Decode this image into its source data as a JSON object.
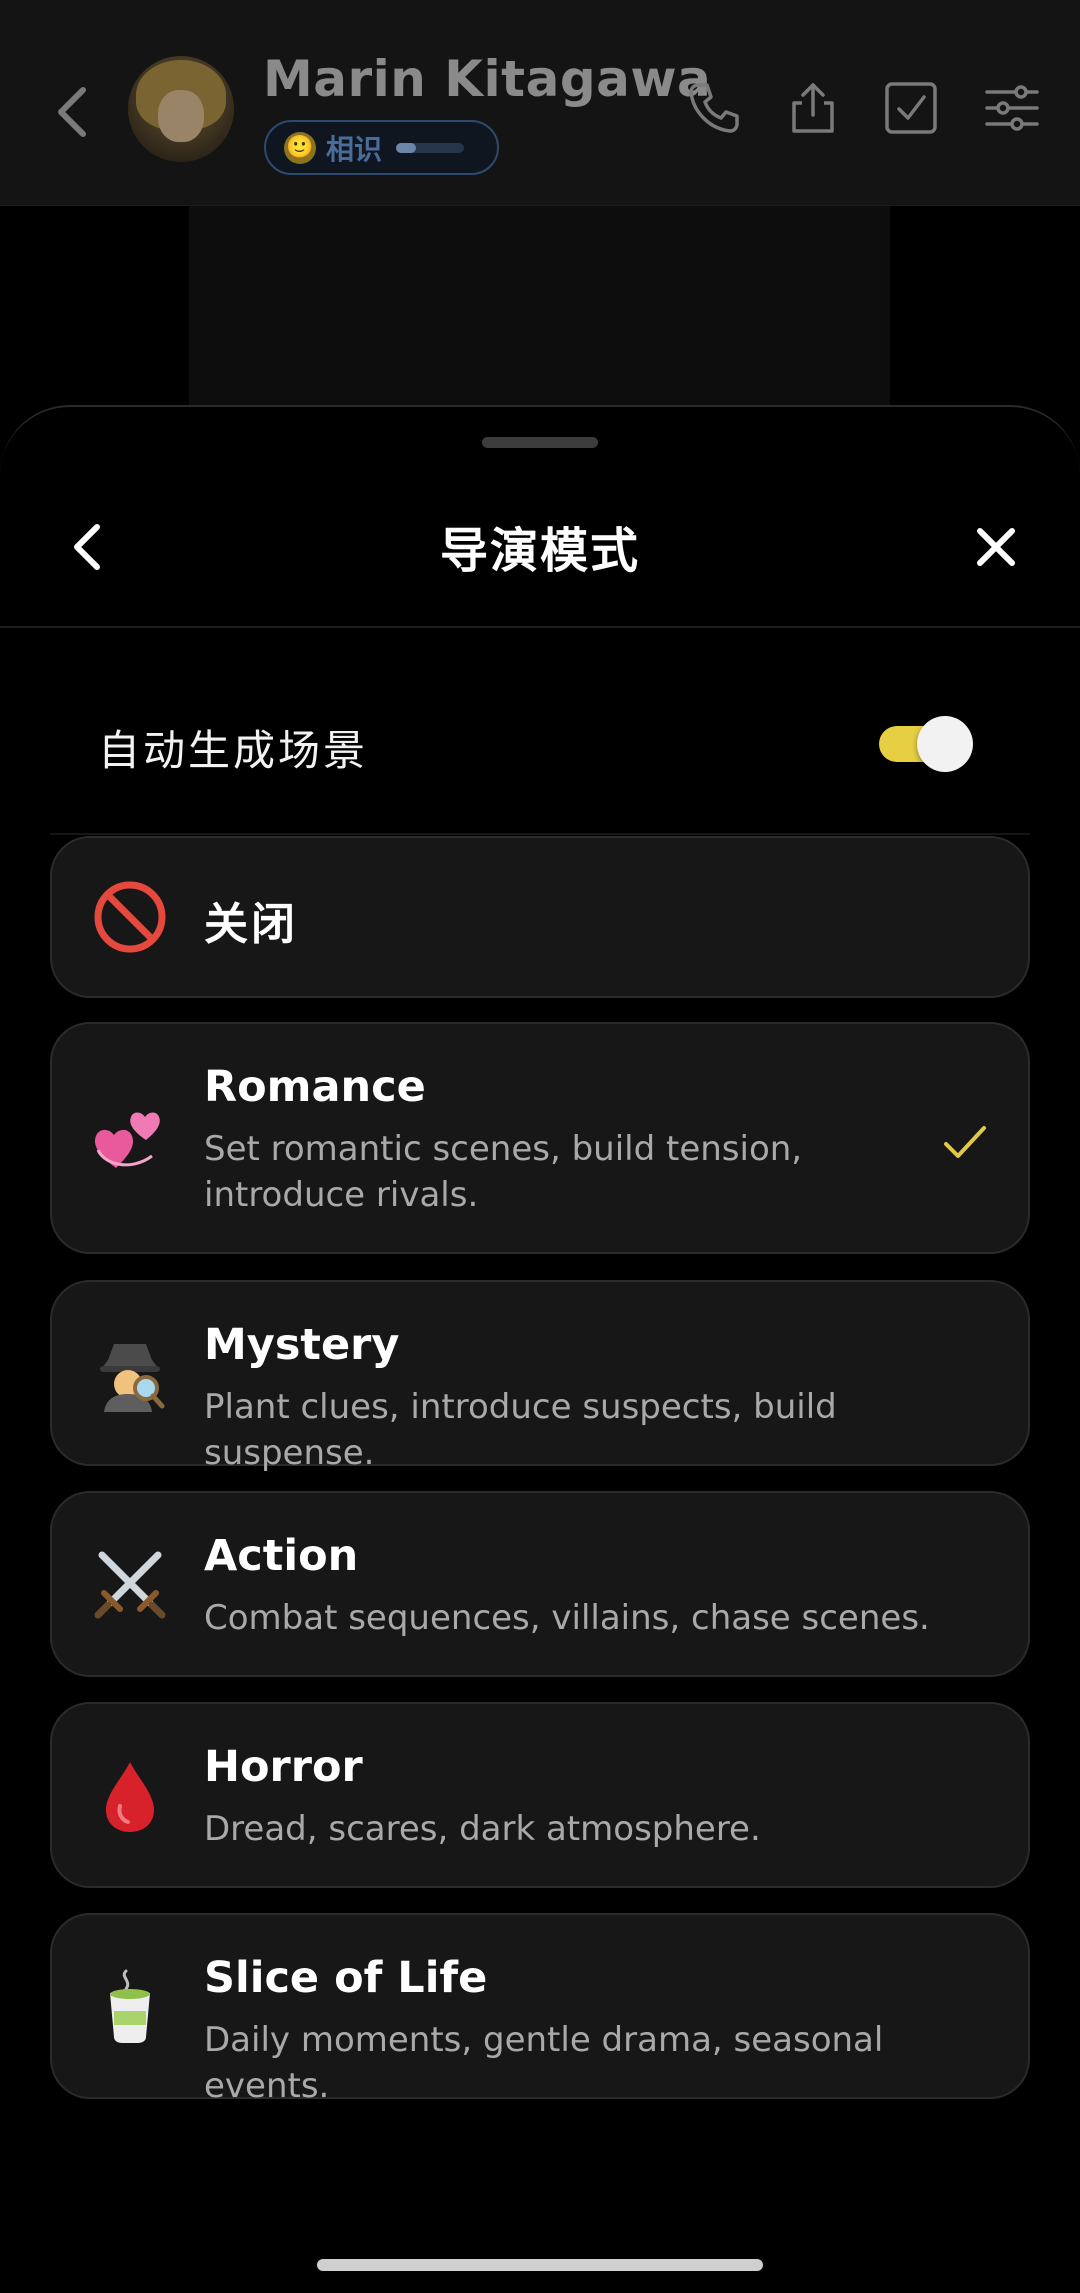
{
  "chat_header": {
    "contact_name": "Marin Kitagawa",
    "relationship_label": "相识",
    "relationship_emoji": "🙂",
    "relationship_progress": 0.3
  },
  "sheet": {
    "title": "导演模式",
    "auto_scene": {
      "label": "自动生成场景",
      "enabled": true,
      "toggle_color": "#e7cf43"
    },
    "modes": [
      {
        "icon": "no-entry-icon",
        "emoji": "🚫",
        "title": "关闭",
        "description": "",
        "selected": false
      },
      {
        "icon": "revolving-hearts-icon",
        "emoji": "💞",
        "title": "Romance",
        "description": "Set romantic scenes, build tension, introduce rivals.",
        "selected": true
      },
      {
        "icon": "detective-icon",
        "emoji": "🕵",
        "title": "Mystery",
        "description": "Plant clues, introduce suspects, build suspense.",
        "selected": false
      },
      {
        "icon": "crossed-swords-icon",
        "emoji": "⚔️",
        "title": "Action",
        "description": "Combat sequences, villains, chase scenes.",
        "selected": false
      },
      {
        "icon": "blood-drop-icon",
        "emoji": "🩸",
        "title": "Horror",
        "description": "Dread, scares, dark atmosphere.",
        "selected": false
      },
      {
        "icon": "tea-cup-icon",
        "emoji": "🍵",
        "title": "Slice of Life",
        "description": "Daily moments, gentle drama, seasonal events.",
        "selected": false
      }
    ],
    "check_color": "#e0c94a"
  }
}
